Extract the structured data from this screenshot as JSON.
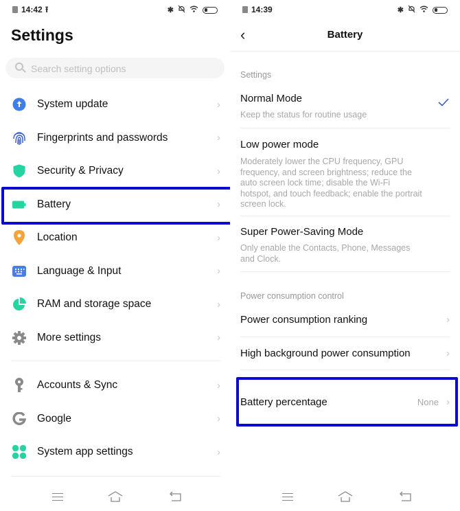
{
  "left": {
    "status_bar": {
      "time": "14:42",
      "upload_icon": "upload-arrow-icon",
      "icons": [
        "bluetooth-icon",
        "mute-icon",
        "wifi-icon",
        "battery-icon"
      ]
    },
    "title": "Settings",
    "search": {
      "placeholder": "Search setting options"
    },
    "groups": [
      [
        {
          "label": "System update",
          "icon": "system-update-icon",
          "color": "#3f7fe8"
        },
        {
          "label": "Fingerprints and passwords",
          "icon": "fingerprint-icon",
          "color": "#3a63c8"
        },
        {
          "label": "Security & Privacy",
          "icon": "shield-icon",
          "color": "#27d3a0"
        },
        {
          "label": "Battery",
          "icon": "battery-icon",
          "color": "#27d3a0"
        },
        {
          "label": "Location",
          "icon": "location-pin-icon",
          "color": "#f3a33a"
        },
        {
          "label": "Language & Input",
          "icon": "keyboard-icon",
          "color": "#4a7de8"
        },
        {
          "label": "RAM and storage space",
          "icon": "pie-chart-icon",
          "color": "#27d3a0"
        },
        {
          "label": "More settings",
          "icon": "gear-icon",
          "color": "#8a8a8a"
        }
      ],
      [
        {
          "label": "Accounts & Sync",
          "icon": "key-icon",
          "color": "#8a8a8a"
        },
        {
          "label": "Google",
          "icon": "google-icon",
          "color": "#8a8a8a"
        },
        {
          "label": "System app settings",
          "icon": "apps-grid-icon",
          "color": "#27d3a0"
        }
      ]
    ],
    "chevron": "›"
  },
  "right": {
    "status_bar": {
      "time": "14:39",
      "icons": [
        "bluetooth-icon",
        "mute-icon",
        "wifi-icon",
        "battery-icon"
      ]
    },
    "back": "‹",
    "title": "Battery",
    "section_settings": "Settings",
    "modes": [
      {
        "title": "Normal Mode",
        "desc": "Keep the status for routine usage",
        "selected": true
      },
      {
        "title": "Low power mode",
        "desc": "Moderately lower the CPU frequency, GPU frequency, and screen brightness; reduce the auto screen lock time; disable the Wi-Fi hotspot, and touch feedback; enable the portrait screen lock.",
        "selected": false
      },
      {
        "title": "Super Power-Saving Mode",
        "desc": "Only enable the Contacts, Phone, Messages and Clock.",
        "selected": false
      }
    ],
    "section_power": "Power consumption control",
    "power_rows": [
      {
        "label": "Power consumption ranking"
      },
      {
        "label": "High background power consumption"
      }
    ],
    "battery_percentage": {
      "label": "Battery percentage",
      "value": "None"
    },
    "chevron": "›"
  },
  "colors": {
    "highlight": "#0a0ad2",
    "accent_check": "#3a5bb8"
  }
}
